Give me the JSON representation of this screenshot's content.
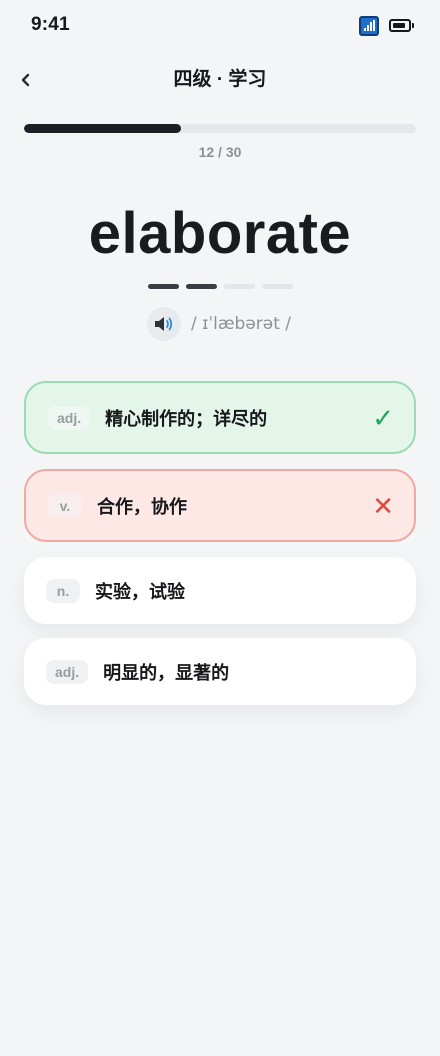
{
  "status": {
    "time": "9:41"
  },
  "header": {
    "back_icon": "chevron-left-icon",
    "title": "四级 · 学习"
  },
  "progress": {
    "current": 12,
    "total": 30,
    "label": "12 / 30",
    "fraction": 0.4
  },
  "word": {
    "text": "elaborate",
    "syllable_dashes": [
      true,
      true,
      false,
      false
    ],
    "phonetic": "/ ɪˈlæbərət /",
    "speaker_icon": "speaker-icon"
  },
  "options": [
    {
      "pos": "adj.",
      "meaning": "精心制作的；详尽的",
      "state": "correct",
      "mark": "✓"
    },
    {
      "pos": "v.",
      "meaning": "合作，协作",
      "state": "wrong",
      "mark": "✕"
    },
    {
      "pos": "n.",
      "meaning": "实验，试验",
      "state": "plain",
      "mark": ""
    },
    {
      "pos": "adj.",
      "meaning": "明显的，显著的",
      "state": "plain",
      "mark": ""
    }
  ],
  "colors": {
    "correct": "#23a35a",
    "wrong": "#e0493f",
    "progress": "#1e1f24",
    "background": "#f4f5f7"
  }
}
